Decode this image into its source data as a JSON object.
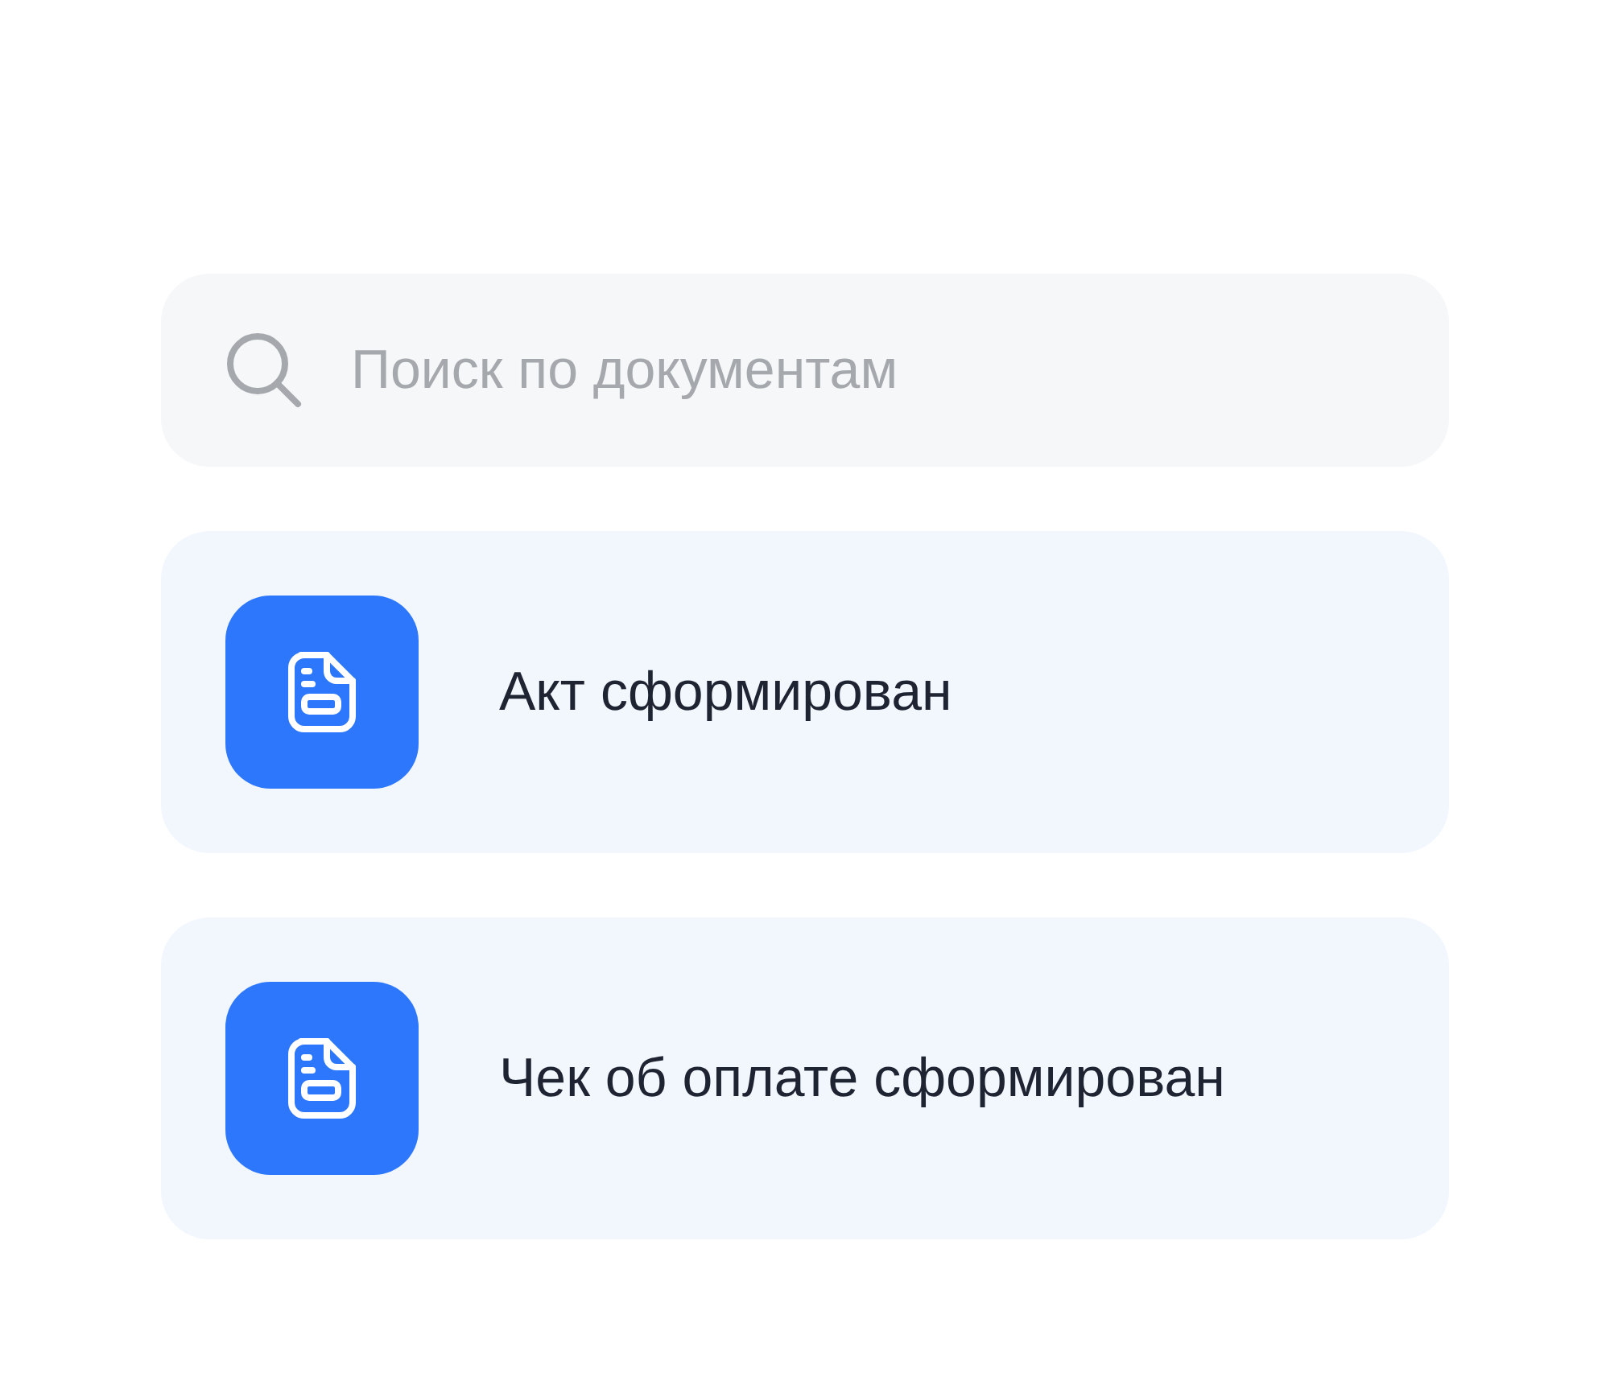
{
  "search": {
    "placeholder": "Поиск по документам"
  },
  "notifications": [
    {
      "text": "Акт сформирован"
    },
    {
      "text": "Чек об оплате сформирован"
    }
  ]
}
